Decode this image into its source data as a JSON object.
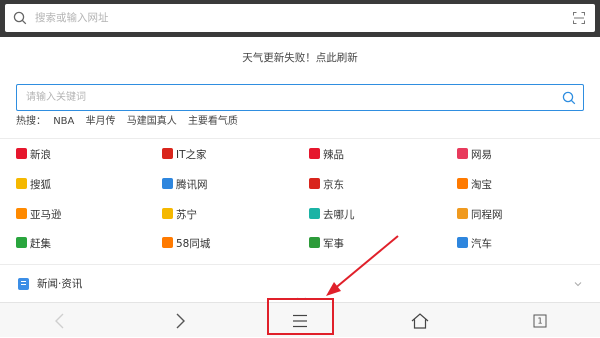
{
  "address_bar": {
    "placeholder": "搜索或输入网址",
    "search_icon": "search-icon",
    "scan_icon": "scan-icon"
  },
  "weather": {
    "message": "天气更新失败！点此刷新"
  },
  "search": {
    "placeholder": "请输入关键词",
    "icon": "search-icon"
  },
  "hot": {
    "label": "热搜：",
    "items": [
      "NBA",
      "芈月传",
      "马建国真人",
      "主要看气质"
    ]
  },
  "sites": [
    {
      "label": "新浪",
      "icon": "sina-icon",
      "color": "#e6162d"
    },
    {
      "label": "IT之家",
      "icon": "ithome-icon",
      "color": "#d9251c"
    },
    {
      "label": "辣品",
      "icon": "lapin-icon",
      "color": "#e6162d"
    },
    {
      "label": "网易",
      "icon": "netease-icon",
      "color": "#e83a5c"
    },
    {
      "label": "搜狐",
      "icon": "sohu-icon",
      "color": "#f5b800"
    },
    {
      "label": "腾讯网",
      "icon": "qq-icon",
      "color": "#2e86de"
    },
    {
      "label": "京东",
      "icon": "jd-icon",
      "color": "#d9251c"
    },
    {
      "label": "淘宝",
      "icon": "taobao-icon",
      "color": "#ff7a00"
    },
    {
      "label": "亚马逊",
      "icon": "amazon-icon",
      "color": "#ff8a00"
    },
    {
      "label": "苏宁",
      "icon": "suning-icon",
      "color": "#f5b800"
    },
    {
      "label": "去哪儿",
      "icon": "qunar-icon",
      "color": "#1bb3a5"
    },
    {
      "label": "同程网",
      "icon": "tongcheng-icon",
      "color": "#f09a1f"
    },
    {
      "label": "赶集",
      "icon": "ganji-icon",
      "color": "#29a53d"
    },
    {
      "label": "58同城",
      "icon": "58-icon",
      "color": "#ff7a00"
    },
    {
      "label": "军事",
      "icon": "military-icon",
      "color": "#2d9b3a"
    },
    {
      "label": "汽车",
      "icon": "car-icon",
      "color": "#2e86de"
    }
  ],
  "news": {
    "label": "新闻·资讯",
    "icon": "news-icon"
  },
  "bottom_bar": {
    "back": "back-icon",
    "forward": "forward-icon",
    "menu": "menu-icon",
    "home": "home-icon",
    "tabs_count": "1"
  },
  "annotation": {
    "highlight_color": "#e0202a"
  }
}
